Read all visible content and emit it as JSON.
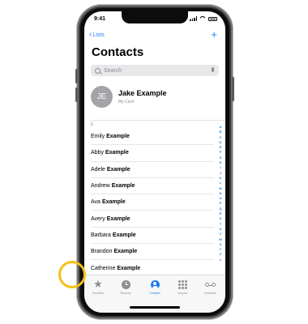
{
  "status": {
    "time": "9:41"
  },
  "nav": {
    "back_label": "Lists",
    "add_label": "+"
  },
  "title": "Contacts",
  "search": {
    "placeholder": "Search"
  },
  "my_card": {
    "initials": "JE",
    "name": "Jake Example",
    "subtitle": "My Card"
  },
  "section_letter": "E",
  "contacts": [
    {
      "first": "Emily",
      "last": "Example"
    },
    {
      "first": "Abby",
      "last": "Example"
    },
    {
      "first": "Adele",
      "last": "Example"
    },
    {
      "first": "Andrew",
      "last": "Example"
    },
    {
      "first": "Ava",
      "last": "Example"
    },
    {
      "first": "Avery",
      "last": "Example"
    },
    {
      "first": "Barbara",
      "last": "Example"
    },
    {
      "first": "Brandon",
      "last": "Example"
    },
    {
      "first": "Catherine",
      "last": "Example"
    }
  ],
  "index_letters": [
    "A",
    "B",
    "C",
    "D",
    "E",
    "F",
    "G",
    "H",
    "I",
    "J",
    "K",
    "L",
    "M",
    "N",
    "O",
    "P",
    "Q",
    "R",
    "S",
    "T",
    "U",
    "V",
    "W",
    "X",
    "Y",
    "Z",
    "#"
  ],
  "tabs": [
    {
      "label": "Favorites",
      "icon": "star-icon"
    },
    {
      "label": "Recents",
      "icon": "clock-icon"
    },
    {
      "label": "Contacts",
      "icon": "person-circle-icon",
      "active": true
    },
    {
      "label": "Keypad",
      "icon": "keypad-icon"
    },
    {
      "label": "Voicemail",
      "icon": "voicemail-icon"
    }
  ],
  "colors": {
    "accent": "#1e7cf2",
    "highlight": "#f4c114"
  }
}
